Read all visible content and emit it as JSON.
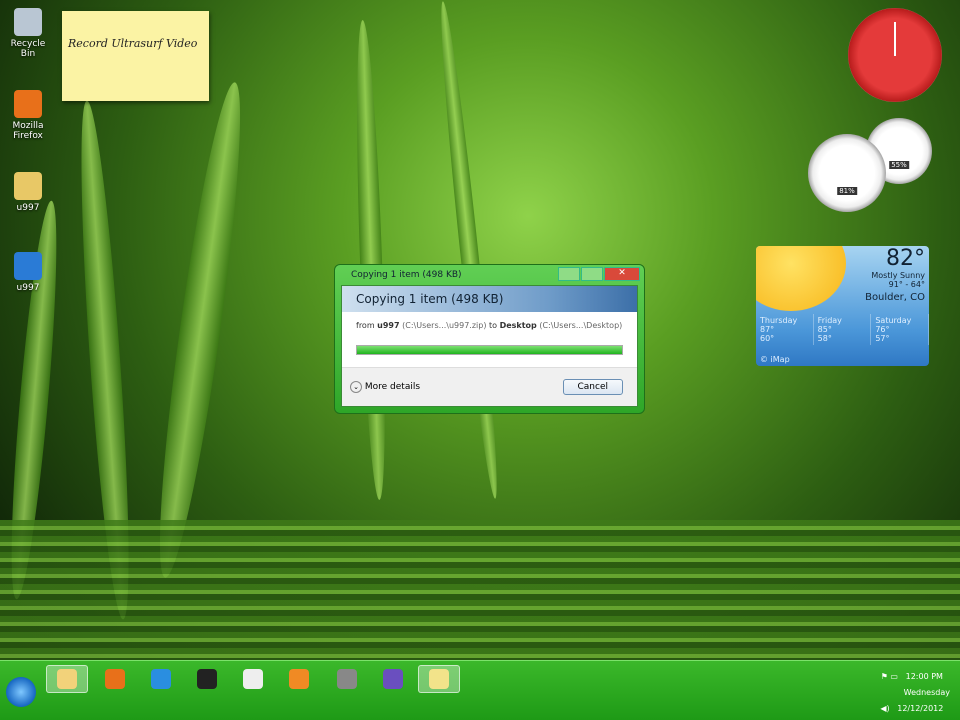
{
  "desktop": {
    "icons": [
      {
        "label": "Recycle Bin",
        "icon": "recycle-bin-icon",
        "color": "#b9c6d3"
      },
      {
        "label": "Mozilla Firefox",
        "icon": "firefox-icon",
        "color": "#e8701a"
      },
      {
        "label": "u997",
        "icon": "folder-icon",
        "color": "#e8c866"
      },
      {
        "label": "u997",
        "icon": "ultrasurf-icon",
        "color": "#2a7bd6"
      }
    ]
  },
  "sticky_note": {
    "text": "Record Ultrasurf Video"
  },
  "gauges": {
    "cpu": "81%",
    "memory": "55%"
  },
  "weather": {
    "temp": "82°",
    "condition": "Mostly Sunny",
    "range": "91° - 64°",
    "location": "Boulder, CO",
    "forecast": [
      {
        "day": "Thursday",
        "high": "87°",
        "low": "60°"
      },
      {
        "day": "Friday",
        "high": "85°",
        "low": "58°"
      },
      {
        "day": "Saturday",
        "high": "76°",
        "low": "57°"
      }
    ],
    "source": "© iMap"
  },
  "dialog": {
    "title": "Copying 1 item (498 KB)",
    "header": "Copying 1 item (498 KB)",
    "from_label": "from",
    "source": "u997",
    "source_path": "(C:\\Users...\\u997.zip)",
    "to_label": "to",
    "dest": "Desktop",
    "dest_path": "(C:\\Users...\\Desktop)",
    "progress": 100,
    "more_details": "More details",
    "cancel": "Cancel",
    "close": "✕"
  },
  "taskbar": {
    "items": [
      {
        "name": "explorer",
        "color": "#f2d27a",
        "active": true
      },
      {
        "name": "firefox",
        "color": "#e8701a"
      },
      {
        "name": "internet-explorer",
        "color": "#2a8ee0"
      },
      {
        "name": "7zip",
        "color": "#222"
      },
      {
        "name": "solitaire",
        "color": "#eee"
      },
      {
        "name": "media-player",
        "color": "#f08a24"
      },
      {
        "name": "settings",
        "color": "#888"
      },
      {
        "name": "ultrasurf",
        "color": "#6a4fbf"
      },
      {
        "name": "copy-window",
        "color": "#f2e38a",
        "active": true
      }
    ],
    "time": "12:00 PM",
    "day": "Wednesday",
    "date": "12/12/2012"
  }
}
